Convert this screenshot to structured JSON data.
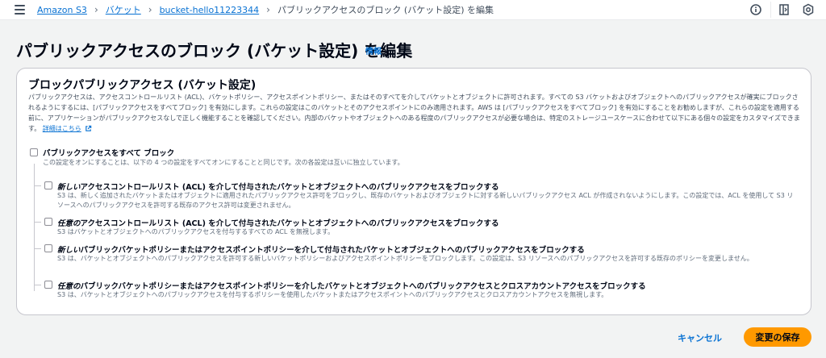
{
  "breadcrumbs": {
    "items": [
      "Amazon S3",
      "バケット",
      "bucket-hello11223344"
    ],
    "current": "パブリックアクセスのブロック (バケット設定) を編集"
  },
  "top_icons": [
    "info-circle-icon",
    "notifications-panel-icon",
    "settings-icon"
  ],
  "header": {
    "title": "パブリックアクセスのブロック (バケット設定) を編集",
    "info_link": "情報"
  },
  "panel": {
    "title": "ブロックパブリックアクセス (バケット設定)",
    "description": "パブリックアクセスは、アクセスコントロールリスト (ACL)、バケットポリシー、アクセスポイントポリシー、またはそのすべてを介してバケットとオブジェクトに許可されます。すべての S3 バケットおよびオブジェクトへのパブリックアクセスが確実にブロックされるようにするには、[パブリックアクセスをすべてブロック] を有効にします。これらの設定はこのバケットとそのアクセスポイントにのみ適用されます。AWS は [パブリックアクセスをすべてブロック] を有効にすることをお勧めしますが、これらの設定を適用する前に、アプリケーションがパブリックアクセスなしで正しく機能することを確認してください。内部のバケットやオブジェクトへのある程度のパブリックアクセスが必要な場合は、特定のストレージユースケースに合わせて以下にある個々の設定をカスタマイズできます。",
    "learn_more": "詳細はこちら"
  },
  "block_all": {
    "label": "パブリックアクセスをすべて ブロック",
    "description": "この設定をオンにすることは、以下の 4 つの設定をすべてオンにすることと同じです。次の各設定は互いに独立しています。",
    "checked": false
  },
  "options": [
    {
      "emphasis": "新しい",
      "label": "アクセスコントロールリスト (ACL) を介して付与されたバケットとオブジェクトへのパブリックアクセスをブロックする",
      "description": "S3 は、新しく追加されたバケットまたはオブジェクトに適用されたパブリックアクセス許可をブロックし、既存のバケットおよびオブジェクトに対する新しいパブリックアクセス ACL が作成されないようにします。この設定では、ACL を使用して S3 リソースへのパブリックアクセスを許可する既存のアクセス許可は変更されません。",
      "checked": false
    },
    {
      "emphasis": "任意の",
      "label": "アクセスコントロールリスト (ACL) を介して付与されたバケットとオブジェクトへのパブリックアクセスをブロックする",
      "description": "S3 はバケットとオブジェクトへのパブリックアクセスを付与するすべての ACL を無視します。",
      "checked": false
    },
    {
      "emphasis": "新しい",
      "label": "パブリックバケットポリシーまたはアクセスポイントポリシーを介して付与されたバケットとオブジェクトへのパブリックアクセスをブロックする",
      "description": "S3 は、バケットとオブジェクトへのパブリックアクセスを許可する新しいバケットポリシーおよびアクセスポイントポリシーをブロックします。この設定は、S3 リソースへのパブリックアクセスを許可する既存のポリシーを変更しません。",
      "checked": false
    },
    {
      "emphasis": "任意の",
      "label": "パブリックバケットポリシーまたはアクセスポイントポリシーを介したバケットとオブジェクトへのパブリックアクセスとクロスアカウントアクセスをブロックする",
      "description": "S3 は、バケットとオブジェクトへのパブリックアクセスを付与するポリシーを使用したバケットまたはアクセスポイントへのパブリックアクセスとクロスアカウントアクセスを無視します。",
      "checked": false
    }
  ],
  "footer": {
    "cancel": "キャンセル",
    "save": "変更の保存"
  },
  "colors": {
    "link": "#0972d3",
    "primary_button": "#ff9900",
    "background": "#f2f3f3"
  }
}
